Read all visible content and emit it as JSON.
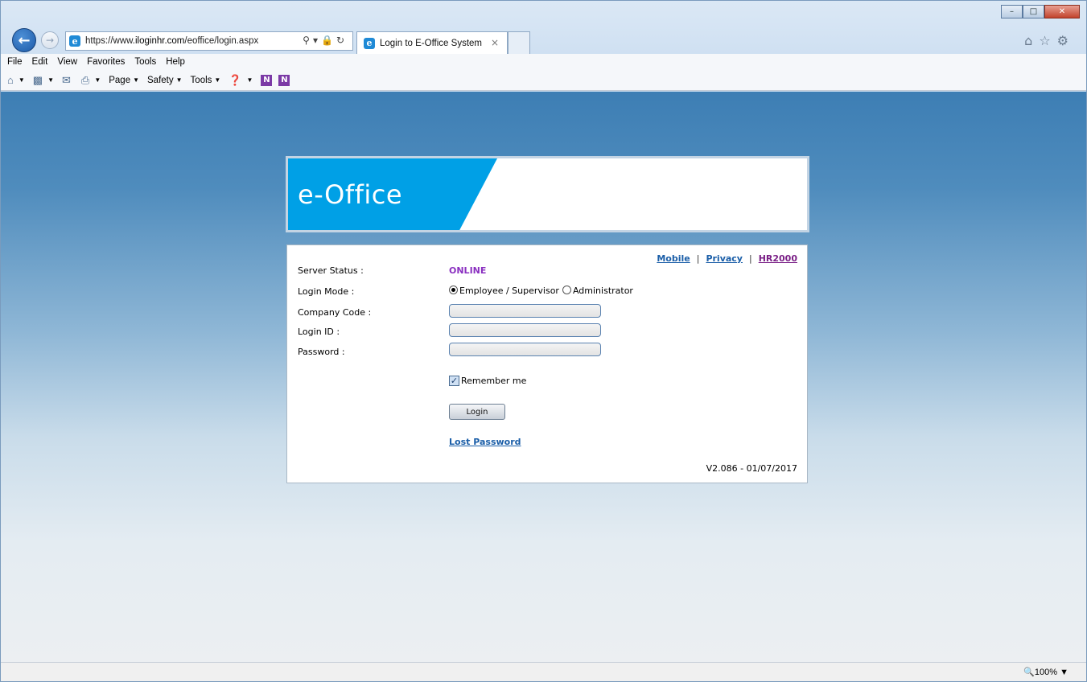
{
  "browser": {
    "url_prefix": "https://www.",
    "url_host": "iloginhr.com",
    "url_path": "/eoffice/login.aspx",
    "tab_title": "Login to E-Office System",
    "tab_close": "×",
    "zoom": "100%"
  },
  "menu": {
    "items": [
      "File",
      "Edit",
      "View",
      "Favorites",
      "Tools",
      "Help"
    ]
  },
  "commandbar": {
    "page": "Page",
    "safety": "Safety",
    "tools": "Tools"
  },
  "banner": {
    "title": "e-Office",
    "accent_color": "#00a0e6"
  },
  "login": {
    "links": {
      "mobile": "Mobile",
      "privacy": "Privacy",
      "hr2000": "HR2000",
      "separator": "|"
    },
    "server_status_label": "Server Status :",
    "server_status_value": "ONLINE",
    "login_mode_label": "Login Mode :",
    "mode_employee": "Employee / Supervisor",
    "mode_admin": "Administrator",
    "mode_selected": "Employee / Supervisor",
    "company_code_label": "Company Code :",
    "company_code_value": "",
    "login_id_label": "Login ID :",
    "login_id_value": "",
    "password_label": "Password :",
    "password_value": "",
    "remember_me_label": "Remember me",
    "remember_me_checked": true,
    "login_button": "Login",
    "lost_password": "Lost Password",
    "version": "V2.086 - 01/07/2017"
  }
}
